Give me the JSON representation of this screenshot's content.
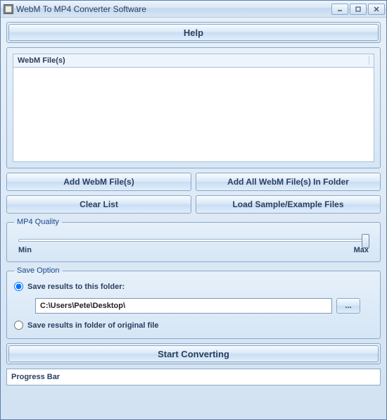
{
  "titlebar": {
    "title": "WebM To MP4 Converter Software"
  },
  "help": {
    "label": "Help"
  },
  "fileList": {
    "header": "WebM File(s)"
  },
  "buttons": {
    "addFiles": "Add WebM File(s)",
    "addFolder": "Add All WebM File(s) In Folder",
    "clear": "Clear List",
    "loadSample": "Load Sample/Example Files",
    "start": "Start Converting",
    "browse": "..."
  },
  "quality": {
    "legend": "MP4 Quality",
    "min": "Min",
    "max": "Max"
  },
  "save": {
    "legend": "Save Option",
    "opt1": "Save results to this folder:",
    "opt2": "Save results in folder of original file",
    "path": "C:\\Users\\Pete\\Desktop\\"
  },
  "progress": {
    "label": "Progress Bar"
  }
}
